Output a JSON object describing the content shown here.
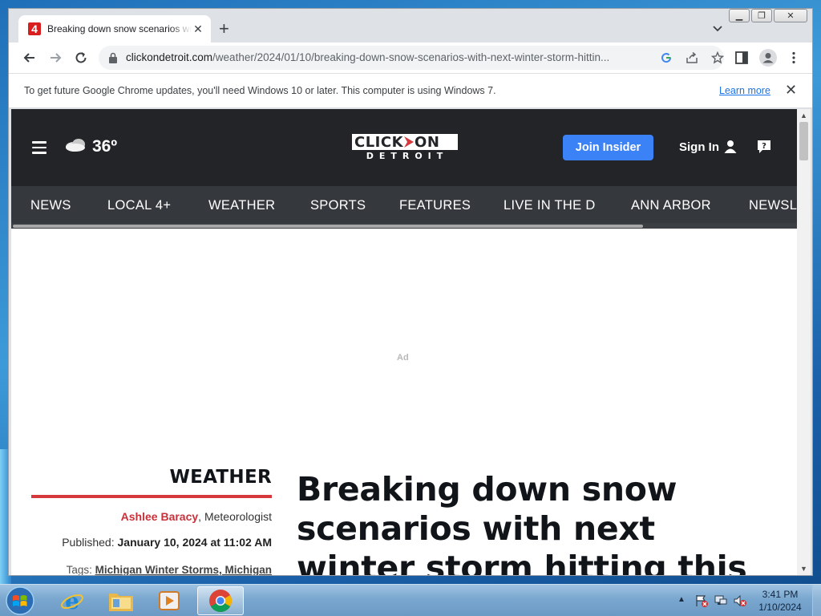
{
  "browser": {
    "tab": {
      "title": "Breaking down snow scenarios with next winter storm hitting this weekend",
      "favicon_text": "4"
    },
    "url": {
      "host": "clickondetroit.com",
      "path": "/weather/2024/01/10/breaking-down-snow-scenarios-with-next-winter-storm-hittin..."
    },
    "infobar": {
      "message": "To get future Google Chrome updates, you'll need Windows 10 or later. This computer is using Windows 7.",
      "link": "Learn more"
    }
  },
  "site": {
    "temperature": "36º",
    "logo": {
      "top_left": "CLICK",
      "top_right": "ON",
      "bottom": "DETROIT"
    },
    "join_label": "Join Insider",
    "signin_label": "Sign In",
    "nav": [
      "NEWS",
      "LOCAL 4+",
      "WEATHER",
      "SPORTS",
      "FEATURES",
      "LIVE IN THE D",
      "ANN ARBOR",
      "NEWSLE"
    ],
    "ad_label": "Ad"
  },
  "article": {
    "section": "WEATHER",
    "author": "Ashlee Baracy",
    "author_role": ", Meteorologist",
    "published_label": "Published: ",
    "published_date": "January 10, 2024 at 11:02 AM",
    "tags_label": "Tags: ",
    "tags": "Michigan Winter Storms, Michigan",
    "headline": "Breaking down snow scenarios with next winter storm hitting this"
  },
  "taskbar": {
    "time": "3:41 PM",
    "date": "1/10/2024",
    "pinned": [
      "internet-explorer",
      "file-explorer",
      "media-player",
      "chrome"
    ]
  },
  "colors": {
    "site_header": "#222427",
    "site_nav": "#35383d",
    "join_button": "#3b82f6",
    "accent_red": "#d6393c"
  }
}
